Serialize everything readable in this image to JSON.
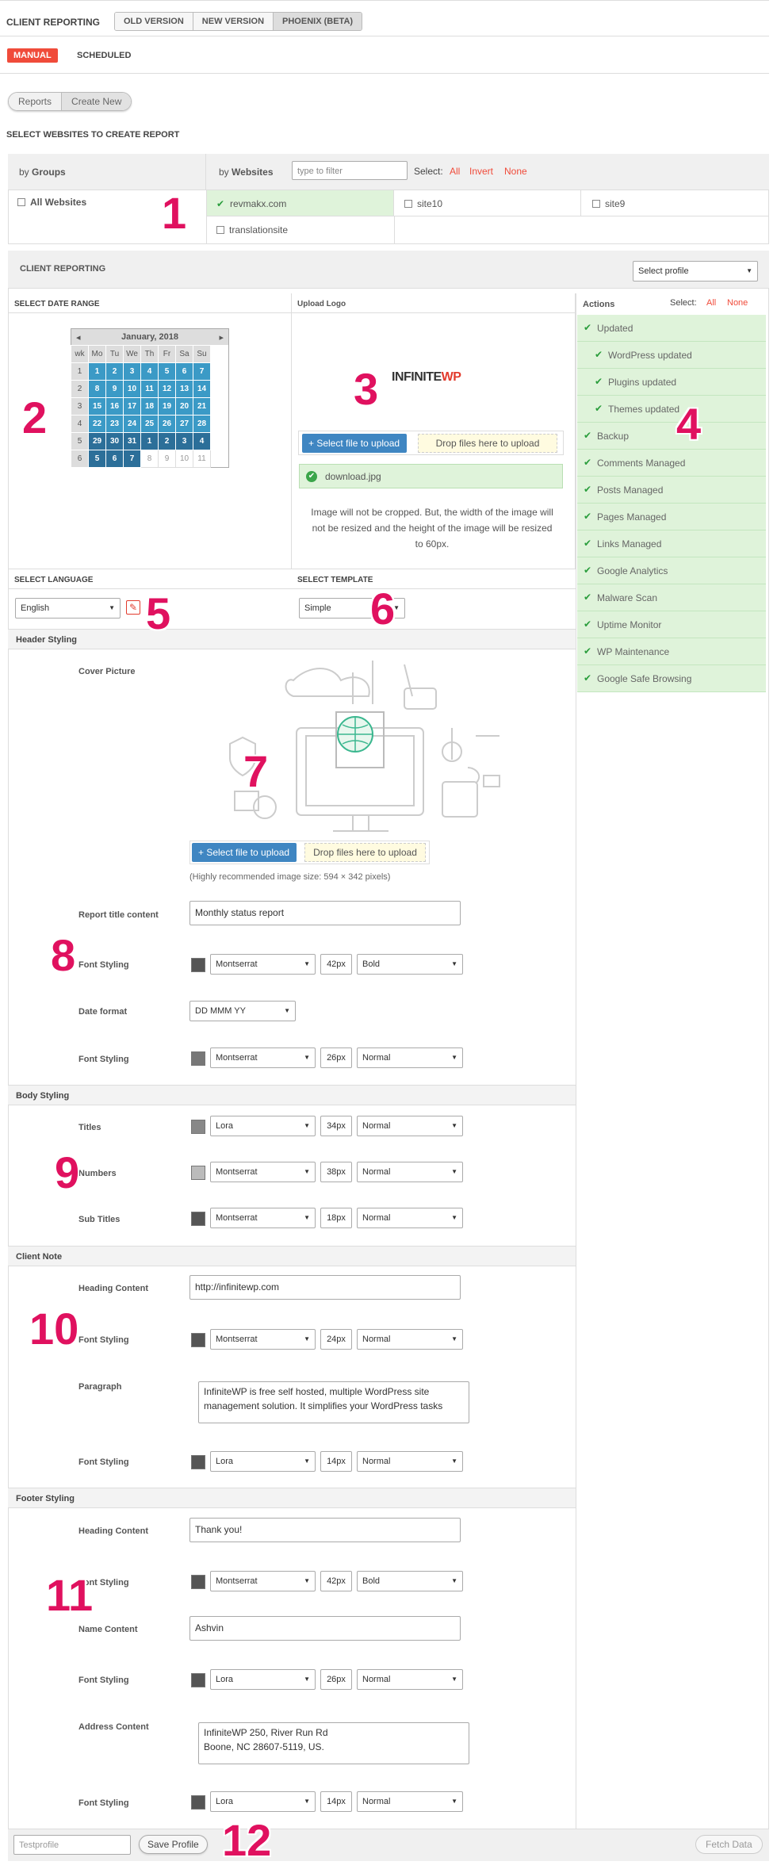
{
  "header": {
    "title": "CLIENT REPORTING",
    "tabs": [
      "OLD VERSION",
      "NEW VERSION",
      "PHOENIX (BETA)"
    ]
  },
  "mode": {
    "manual": "MANUAL",
    "scheduled": "SCHEDULED"
  },
  "nav": {
    "reports": "Reports",
    "create_new": "Create New"
  },
  "select_title": "SELECT WEBSITES TO CREATE REPORT",
  "websites": {
    "by": "by",
    "groups": "Groups",
    "websites_lbl": "Websites",
    "filter_placeholder": "type to filter",
    "select_lbl": "Select:",
    "all": "All",
    "invert": "Invert",
    "none": "None",
    "all_websites": "All Websites",
    "sites": [
      "revmakx.com",
      "site10",
      "site9",
      "translationsite"
    ]
  },
  "client_reporting": {
    "title": "CLIENT REPORTING",
    "profile": "Select profile"
  },
  "date": {
    "title": "SELECT DATE RANGE",
    "month": "January, 2018",
    "weekdays": [
      "wk",
      "Mo",
      "Tu",
      "We",
      "Th",
      "Fr",
      "Sa",
      "Su"
    ],
    "rows": [
      [
        "1",
        "1",
        "2",
        "3",
        "4",
        "5",
        "6",
        "7"
      ],
      [
        "2",
        "8",
        "9",
        "10",
        "11",
        "12",
        "13",
        "14"
      ],
      [
        "3",
        "15",
        "16",
        "17",
        "18",
        "19",
        "20",
        "21"
      ],
      [
        "4",
        "22",
        "23",
        "24",
        "25",
        "26",
        "27",
        "28"
      ],
      [
        "5",
        "29",
        "30",
        "31",
        "1",
        "2",
        "3",
        "4"
      ],
      [
        "6",
        "5",
        "6",
        "7",
        "8",
        "9",
        "10",
        "11"
      ]
    ]
  },
  "logo": {
    "title": "Upload Logo",
    "brand": "INFINITE",
    "brand2": "WP",
    "select_btn": "+ Select file to upload",
    "drop": "Drop files here to upload",
    "file": "download.jpg",
    "note": "Image will not be cropped. But, the width of the image will not be resized and the height of the image will be resized to 60px."
  },
  "actions": {
    "title": "Actions",
    "select": "Select:",
    "all": "All",
    "none": "None",
    "items": [
      "Updated",
      "WordPress updated",
      "Plugins updated",
      "Themes updated",
      "Backup",
      "Comments Managed",
      "Posts Managed",
      "Pages Managed",
      "Links Managed",
      "Google Analytics",
      "Malware Scan",
      "Uptime Monitor",
      "WP Maintenance",
      "Google Safe Browsing"
    ]
  },
  "language": {
    "title": "SELECT LANGUAGE",
    "value": "English"
  },
  "template": {
    "title": "SELECT TEMPLATE",
    "value": "Simple"
  },
  "header_styling": {
    "title": "Header Styling",
    "cover": "Cover Picture",
    "select_btn": "+ Select file to upload",
    "drop": "Drop files here to upload",
    "hint": "(Highly recommended image size: 594 × 342 pixels)",
    "report_title_lbl": "Report title content",
    "report_title": "Monthly status report",
    "font1_lbl": "Font Styling",
    "font1": "Montserrat",
    "size1": "42px",
    "weight1": "Bold",
    "date_lbl": "Date format",
    "date": "DD MMM YY",
    "font2_lbl": "Font Styling",
    "font2": "Montserrat",
    "size2": "26px",
    "weight2": "Normal"
  },
  "body_styling": {
    "title": "Body Styling",
    "titles_lbl": "Titles",
    "titles_font": "Lora",
    "titles_size": "34px",
    "titles_weight": "Normal",
    "numbers_lbl": "Numbers",
    "numbers_font": "Montserrat",
    "numbers_size": "38px",
    "numbers_weight": "Normal",
    "sub_lbl": "Sub Titles",
    "sub_font": "Montserrat",
    "sub_size": "18px",
    "sub_weight": "Normal"
  },
  "client_note": {
    "title": "Client Note",
    "heading_lbl": "Heading Content",
    "heading": "http://infinitewp.com",
    "font1_lbl": "Font Styling",
    "font1": "Montserrat",
    "size1": "24px",
    "weight1": "Normal",
    "para_lbl": "Paragraph",
    "para": "InfiniteWP is free self hosted, multiple WordPress site management solution. It simplifies your WordPress tasks",
    "font2_lbl": "Font Styling",
    "font2": "Lora",
    "size2": "14px",
    "weight2": "Normal"
  },
  "footer_styling": {
    "title": "Footer Styling",
    "heading_lbl": "Heading Content",
    "heading": "Thank you!",
    "font1_lbl": "Font Styling",
    "font1": "Montserrat",
    "size1": "42px",
    "weight1": "Bold",
    "name_lbl": "Name Content",
    "name": "Ashvin",
    "font2_lbl": "Font Styling",
    "font2": "Lora",
    "size2": "26px",
    "weight2": "Normal",
    "address_lbl": "Address Content",
    "address1": "InfiniteWP 250, River Run Rd",
    "address2": "Boone, NC 28607-5119, US.",
    "font3_lbl": "Font Styling",
    "font3": "Lora",
    "size3": "14px",
    "weight3": "Normal"
  },
  "bottom": {
    "profile_placeholder": "Testprofile",
    "save": "Save Profile",
    "fetch": "Fetch Data"
  },
  "markers": [
    "1",
    "2",
    "3",
    "4",
    "5",
    "6",
    "7",
    "8",
    "9",
    "10",
    "11",
    "12"
  ],
  "colors": {
    "accent": "#f04b3a",
    "green": "#dff3da",
    "blue": "#3f86c2"
  }
}
